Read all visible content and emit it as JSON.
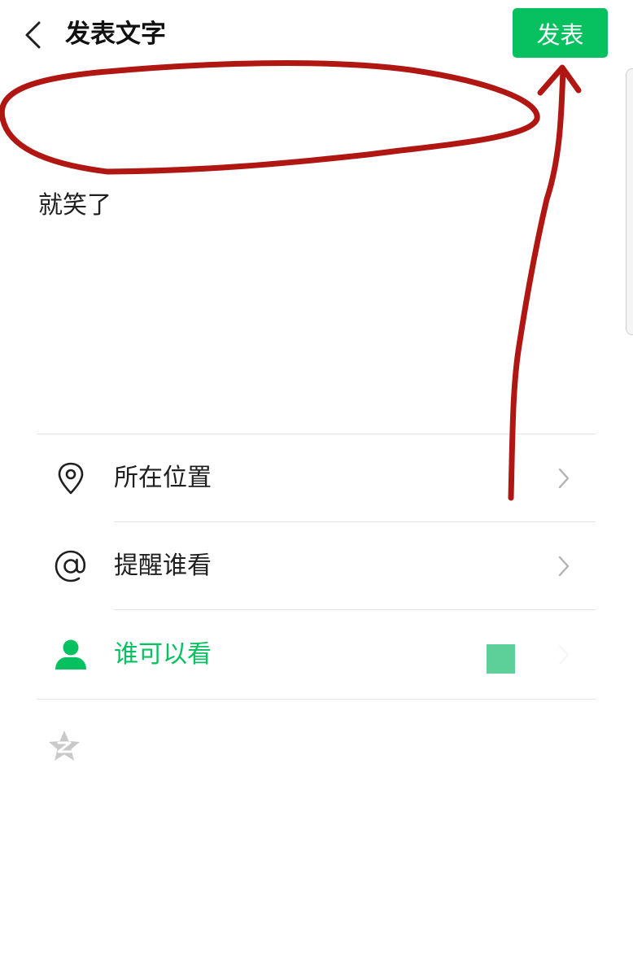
{
  "header": {
    "title": "发表文字",
    "publish_label": "发表"
  },
  "post": {
    "text": "就笑了"
  },
  "options": [
    {
      "label": "所在位置",
      "icon": "location-pin-icon"
    },
    {
      "label": "提醒谁看",
      "icon": "at-mention-icon"
    },
    {
      "label": "谁可以看",
      "icon": "person-icon",
      "active": true
    }
  ],
  "icons": {
    "back": "chevron-left-icon",
    "row_arrow": "chevron-right-icon",
    "share_to_qzone": "qzone-star-icon"
  },
  "colors": {
    "accent": "#07c160",
    "annotation": "#b01612",
    "divider": "#e6e6e6",
    "muted_icon": "#c9c9c9"
  }
}
